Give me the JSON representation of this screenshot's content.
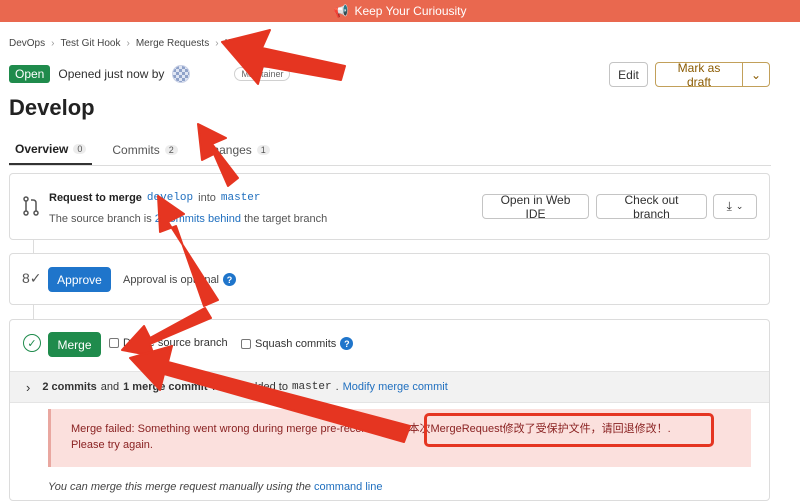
{
  "banner": {
    "text": "Keep Your Curiousity",
    "icon": "megaphone-icon"
  },
  "breadcrumb": [
    "DevOps",
    "Test Git Hook",
    "Merge Requests",
    "!2"
  ],
  "header": {
    "status": "Open",
    "opened_text": "Opened just now by",
    "role": "Maintainer",
    "edit_label": "Edit",
    "draft_label": "Mark as draft"
  },
  "title": "Develop",
  "tabs": [
    {
      "label": "Overview",
      "count": "0"
    },
    {
      "label": "Commits",
      "count": "2"
    },
    {
      "label": "Changes",
      "count": "1"
    }
  ],
  "request": {
    "title": "Request to merge",
    "source": "develop",
    "into": "into",
    "target": "master",
    "sub_prefix": "The source branch is",
    "behind_link": "2 commits behind",
    "sub_suffix": "the target branch",
    "web_ide": "Open in Web IDE",
    "checkout": "Check out branch"
  },
  "approval": {
    "button": "Approve",
    "text": "Approval is optional"
  },
  "merge": {
    "button": "Merge",
    "delete_label": "Delete source branch",
    "squash_label": "Squash commits",
    "commits_count": "2 commits",
    "and": "and",
    "merge_commits": "1 merge commit",
    "will_be_added": "will be added to",
    "target": "master",
    "modify_link": "Modify merge commit",
    "error_line1": "Merge failed: Something went wrong during merge pre-receive hook: 本次MergeRequest修改了受保护文件，请回退修改！.",
    "error_line2": "Please try again.",
    "footer_text": "You can merge this merge request manually using the",
    "footer_link": "command line"
  },
  "colors": {
    "banner": "#e9684f",
    "open": "#1f8b4c",
    "primary": "#1f75cb",
    "annotation": "#e53521"
  }
}
